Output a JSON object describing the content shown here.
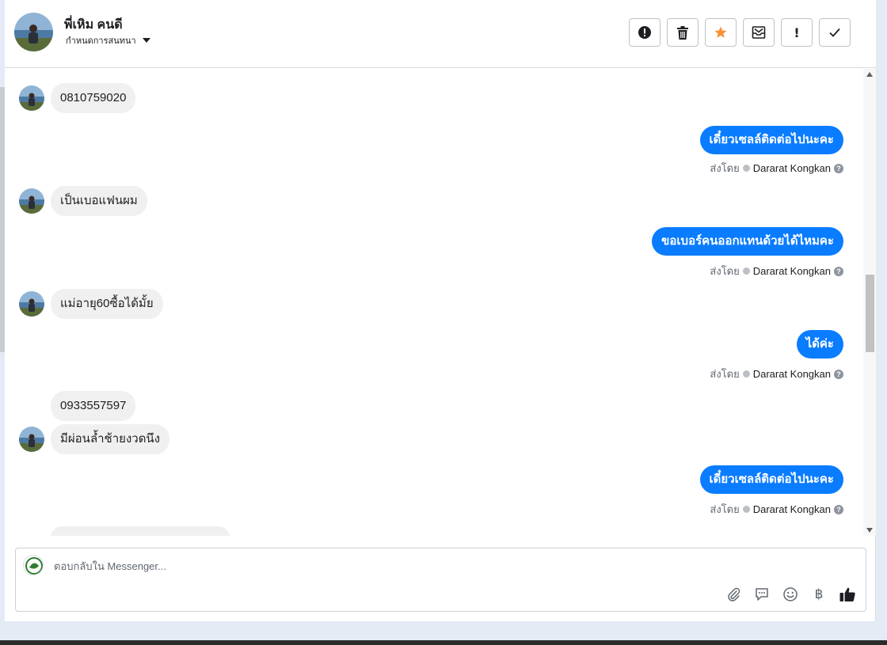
{
  "header": {
    "contact_name": "พี่เหิม คนดี",
    "assign_label": "กำหนดการสนทนา",
    "actions": [
      {
        "name": "spam",
        "icon": "alert-circle-icon"
      },
      {
        "name": "delete",
        "icon": "trash-icon"
      },
      {
        "name": "star",
        "icon": "star-icon",
        "color": "#f7923b"
      },
      {
        "name": "move-to-inbox",
        "icon": "inbox-icon"
      },
      {
        "name": "follow-up",
        "icon": "exclamation-icon",
        "label": "!"
      },
      {
        "name": "mark-done",
        "icon": "check-icon"
      }
    ]
  },
  "messages": [
    {
      "direction": "in",
      "text": "0810759020",
      "show_avatar": true
    },
    {
      "direction": "out",
      "text": "เดี๋ยวเซลล์ติดต่อไปนะคะ",
      "sent_by_label": "ส่งโดย",
      "sender": "Dararat Kongkan"
    },
    {
      "direction": "in",
      "text": "เป็นเบอแฟนผม",
      "show_avatar": true
    },
    {
      "direction": "out",
      "text": "ขอเบอร์คนออกแทนด้วยได้ไหมคะ",
      "sent_by_label": "ส่งโดย",
      "sender": "Dararat Kongkan"
    },
    {
      "direction": "in",
      "text": "แม่อายุ60ซื้อได้มั้ย",
      "show_avatar": true
    },
    {
      "direction": "out",
      "text": "ได้ค่ะ",
      "sent_by_label": "ส่งโดย",
      "sender": "Dararat Kongkan"
    },
    {
      "direction": "in",
      "text": "0933557597",
      "show_avatar": false
    },
    {
      "direction": "in",
      "text": "มีผ่อนล้ำช้ายงวดนึง",
      "show_avatar": true
    },
    {
      "direction": "out",
      "text": "เดี๋ยวเซลล์ติดต่อไปนะคะ",
      "sent_by_label": "ส่งโดย",
      "sender": "Dararat Kongkan"
    }
  ],
  "composer": {
    "placeholder": "ตอบกลับใน Messenger...",
    "tools": [
      "paperclip-icon",
      "saved-reply-icon",
      "emoji-icon",
      "baht-icon",
      "thumbs-up-icon"
    ],
    "baht_symbol": "฿"
  },
  "colors": {
    "outgoing_bubble": "#0a7cff",
    "incoming_bubble": "#f0f0f0",
    "star": "#f7923b"
  }
}
